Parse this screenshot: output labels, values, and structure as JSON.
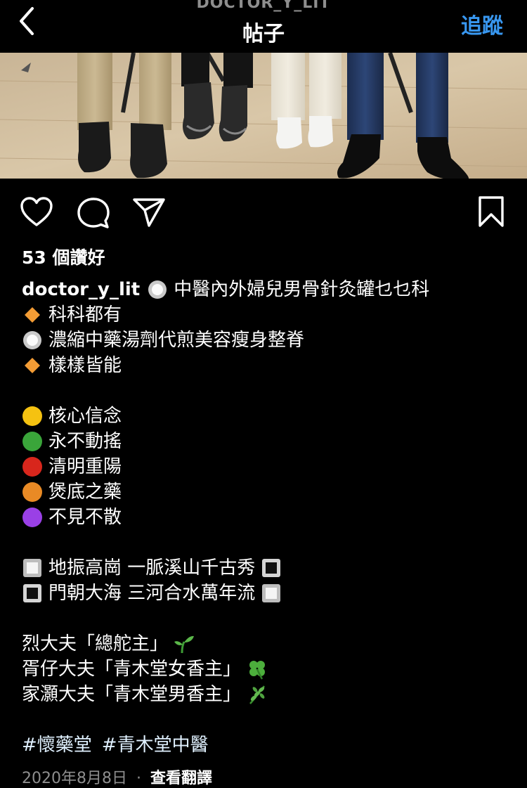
{
  "header": {
    "account_name": "DOCTOR_Y_LIT",
    "title": "帖子",
    "follow_label": "追蹤"
  },
  "post": {
    "likes_text": "53 個讚好",
    "username": "doctor_y_lit",
    "caption": {
      "line1": "中醫內外婦兒男骨針灸罐乜乜科",
      "line2": "科科都有",
      "line3": "濃縮中藥湯劑代煎美容瘦身整脊",
      "line4": "樣樣皆能",
      "line5": "核心信念",
      "line6": "永不動搖",
      "line7": "清明重陽",
      "line8": "煲底之藥",
      "line9": "不見不散",
      "line10": "地振高崗 一脈溪山千古秀",
      "line11": "門朝大海 三河合水萬年流",
      "line12": "烈大夫「總舵主」",
      "line13": "胥仔大夫「青木堂女香主」",
      "line14": "家灝大夫「青木堂男香主」"
    },
    "hashtags": [
      "#懷藥堂",
      "#青木堂中醫"
    ],
    "date": "2020年8月8日",
    "separator": "·",
    "translate_label": "查看翻譯"
  },
  "icons": {
    "back": "chevron-left-icon",
    "like": "heart-icon",
    "comment": "comment-bubble-icon",
    "share": "paper-plane-icon",
    "save": "bookmark-icon"
  },
  "colors": {
    "background": "#000000",
    "accent": "#3897f0",
    "muted": "#8e8e8e",
    "emoji_yellow": "#f5c211",
    "emoji_green": "#3aa53a",
    "emoji_red": "#d8261c",
    "emoji_orange": "#e98a25",
    "emoji_purple": "#9a40e6",
    "emoji_diamond": "#f39c35"
  }
}
